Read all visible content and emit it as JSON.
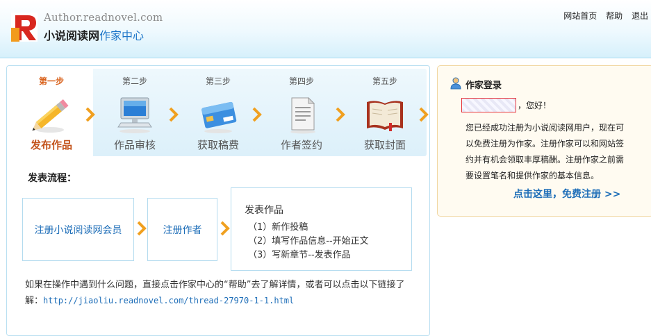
{
  "header": {
    "site_url": "Author.readnovel.com",
    "title_main": "小说阅读网",
    "title_accent": "作家中心",
    "nav": [
      "网站首页",
      "帮助",
      "退出"
    ]
  },
  "steps": [
    {
      "num": "第一步",
      "label": "发布作品",
      "icon": "pencil-icon"
    },
    {
      "num": "第二步",
      "label": "作品审核",
      "icon": "computer-icon"
    },
    {
      "num": "第三步",
      "label": "获取稿费",
      "icon": "credit-card-icon"
    },
    {
      "num": "第四步",
      "label": "作者签约",
      "icon": "document-icon"
    },
    {
      "num": "第五步",
      "label": "获取封面",
      "icon": "book-icon"
    }
  ],
  "flow": {
    "title": "发表流程：",
    "box1": "注册小说阅读网会员",
    "box2": "注册作者",
    "box3_title": "发表作品",
    "box3_items": [
      "（1）新作投稿",
      "（2）填写作品信息--开始正文",
      "（3）写新章节--发表作品"
    ]
  },
  "help": {
    "text": "如果在操作中遇到什么问题，直接点击作家中心的“帮助”去了解详情，或者可以点击以下链接了解：",
    "link": "http://jiaoliu.readnovel.com/thread-27970-1-1.html"
  },
  "login_panel": {
    "title": "作家登录",
    "greeting": "，您好！",
    "body": "您已经成功注册为小说阅读网用户，现在可以免费注册为作家。注册作家可以和网站签约并有机会领取丰厚稿酬。注册作家之前需要设置笔名和提供作家的基本信息。",
    "cta": "点击这里，免费注册 >>"
  },
  "colors": {
    "accent_blue": "#1e76c9",
    "active_orange": "#c3531b",
    "arrow_orange": "#f0a020"
  }
}
